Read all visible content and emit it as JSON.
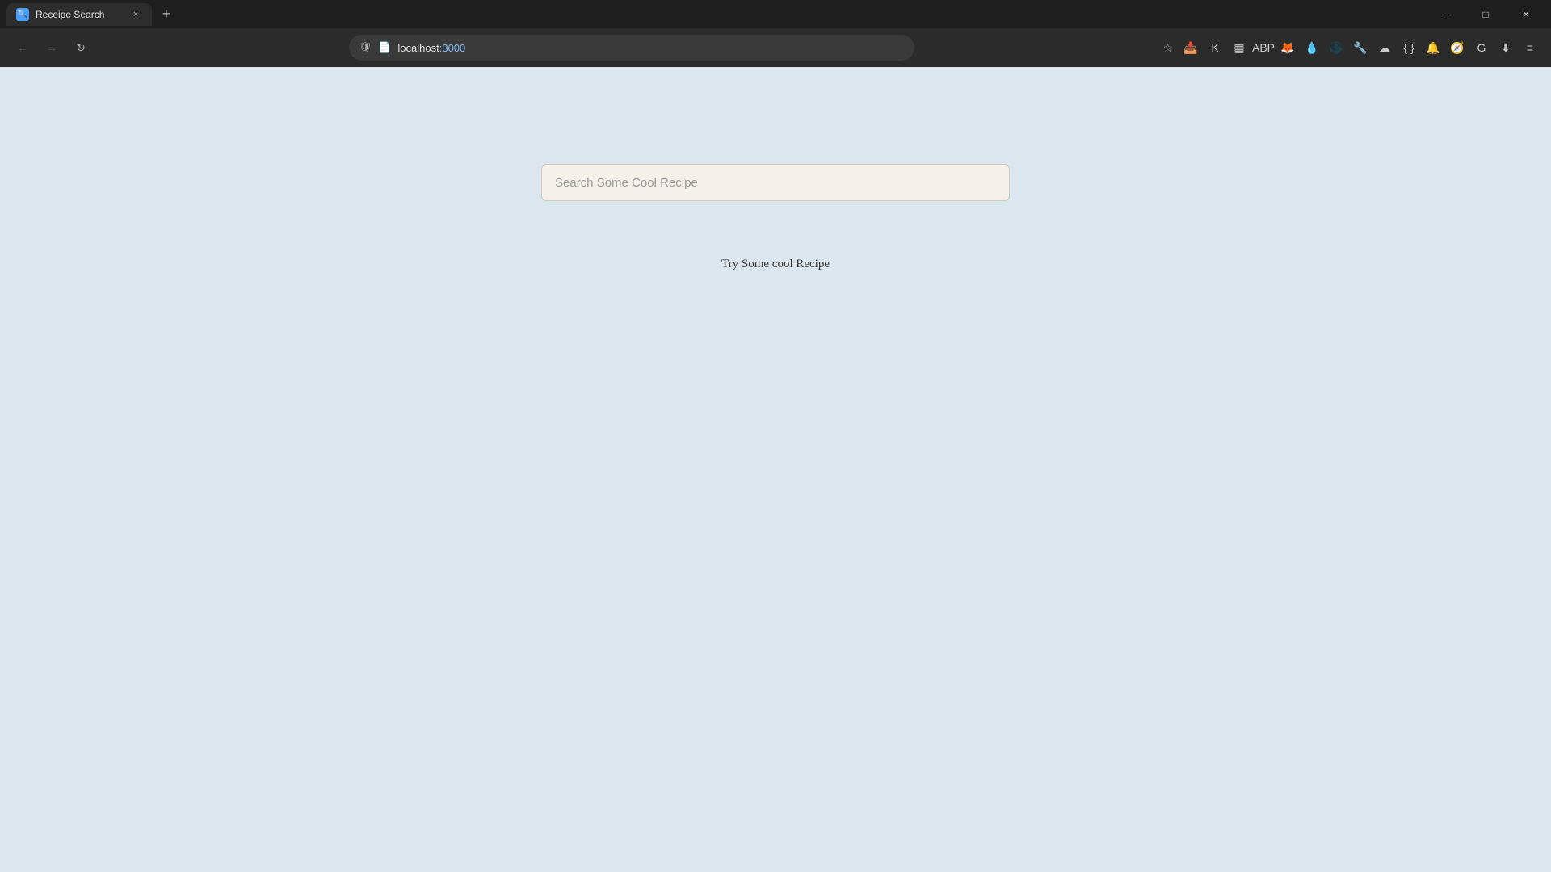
{
  "browser": {
    "tab": {
      "favicon": "🔍",
      "title": "Receipe Search",
      "close_label": "×"
    },
    "new_tab_label": "+",
    "window_controls": {
      "minimize": "─",
      "maximize": "□",
      "close": "✕"
    },
    "address_bar": {
      "url_base": "localhost:",
      "url_port": "3000",
      "security_icon": "🛡",
      "page_icon": "📄"
    },
    "nav": {
      "back": "←",
      "forward": "→",
      "refresh": "↻"
    }
  },
  "page": {
    "search_placeholder": "Search Some Cool Recipe",
    "hint_text": "Try Some cool Recipe"
  }
}
